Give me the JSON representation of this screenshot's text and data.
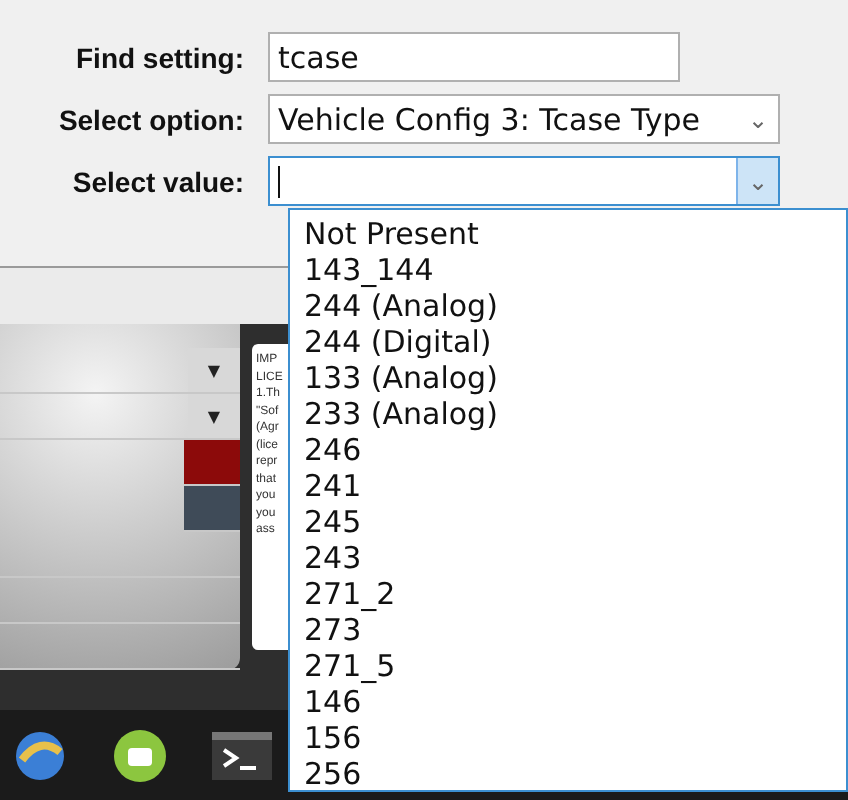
{
  "form": {
    "fields": [
      {
        "kind": "text",
        "label": "Find setting:",
        "value": "tcase"
      },
      {
        "kind": "combo",
        "label": "Select option:",
        "value": "Vehicle Config 3: Tcase Type",
        "expanded": false,
        "caret": "⌄"
      },
      {
        "kind": "combo",
        "label": "Select value:",
        "expanded": true,
        "caret": "⌄"
      }
    ]
  },
  "dropdown": {
    "options": [
      "Not Present",
      "143_144",
      "244 (Analog)",
      "244 (Digital)",
      "133 (Analog)",
      "233 (Analog)",
      "246",
      "241",
      "245",
      "243",
      "271_2",
      "273",
      "271_5",
      "146",
      "156",
      "256"
    ]
  },
  "background_app": {
    "dropdown_arrows": [
      "▼",
      "▼"
    ],
    "license_text": [
      "IMP",
      "LICE",
      "1.Th",
      "\"Sof",
      "(Agr",
      "(lice",
      "repr",
      "that",
      "you",
      "you",
      "ass"
    ]
  }
}
